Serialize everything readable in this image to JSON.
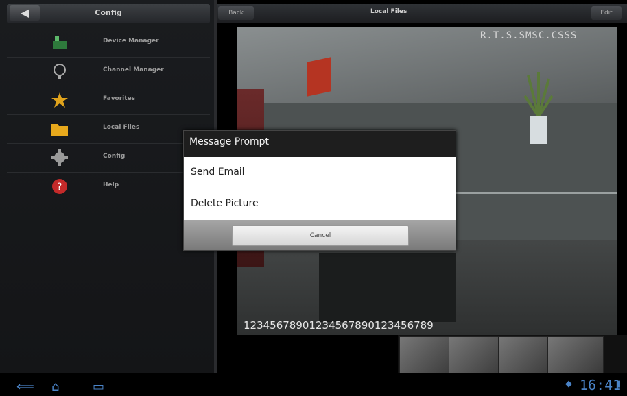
{
  "left_panel": {
    "title": "Config",
    "back_label": "◀",
    "items": [
      {
        "label": "Device Manager",
        "icon": "device-manager-icon"
      },
      {
        "label": "Channel Manager",
        "icon": "channel-manager-icon"
      },
      {
        "label": "Favorites",
        "icon": "star-icon"
      },
      {
        "label": "Local Files",
        "icon": "folder-icon"
      },
      {
        "label": "Config",
        "icon": "gear-icon"
      },
      {
        "label": "Help",
        "icon": "help-icon"
      }
    ]
  },
  "right_panel": {
    "title": "Local Files",
    "back_label": "Back",
    "edit_label": "Edit"
  },
  "camera": {
    "timestamp": "R.T.S.SMSC.CSSS",
    "overlay_numbers": "12345678901234567890123456789"
  },
  "dialog": {
    "title": "Message Prompt",
    "items": [
      "Send Email",
      "Delete Picture"
    ],
    "cancel_label": "Cancel"
  },
  "status_bar": {
    "time": "16:41",
    "colors": {
      "accent": "#4a83c7"
    }
  }
}
